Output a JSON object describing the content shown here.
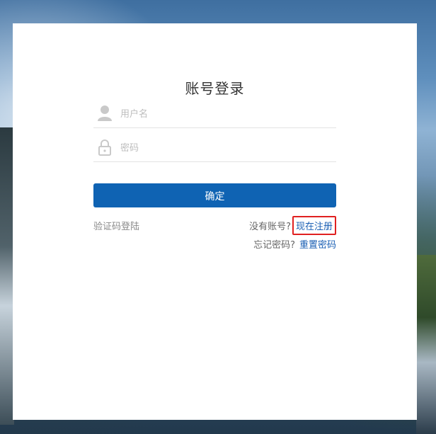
{
  "login": {
    "title": "账号登录",
    "username_placeholder": "用户名",
    "password_placeholder": "密码",
    "confirm_label": "确定",
    "sms_login_label": "验证码登陆",
    "no_account_text": "没有账号?",
    "register_link": "现在注册",
    "forgot_text": "忘记密码?",
    "reset_link": "重置密码",
    "icons": {
      "username": "user-icon",
      "password": "lock-icon"
    }
  },
  "colors": {
    "primary_button": "#0f63b3",
    "link": "#1a5fb4",
    "highlight_box": "#e02020",
    "placeholder": "#bdbdbd"
  }
}
